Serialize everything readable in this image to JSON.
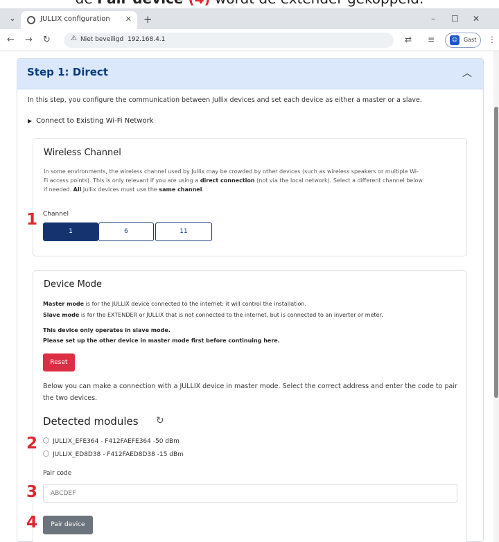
{
  "caption": {
    "prefix": "de ",
    "bold": "Pair device",
    "red": " (4)",
    "suffix": " wordt de extender gekoppeld."
  },
  "browser": {
    "tab_title": "JULLIX configuration",
    "security_label": "Niet beveiligd",
    "url": "192.168.4.1",
    "profile_label": "Gast"
  },
  "accordion": {
    "title": "Step 1: Direct"
  },
  "intro_text": "In this step, you configure the communication between Jullix devices and set each device as either a master or a slave.",
  "wifi_toggle_label": "Connect to Existing Wi-Fi Network",
  "wireless": {
    "title": "Wireless Channel",
    "desc_1": "In some environments, the wireless channel used by Jullix may be crowded by other devices (such as wireless speakers or multiple Wi-",
    "desc_2a": "Fi access points). This is only relevant if you are using a ",
    "desc_2b": "direct connection",
    "desc_2c": " (not via the local network). Select a different channel below",
    "desc_3a": "if needed. ",
    "desc_3b": "All",
    "desc_3c": " Jullix devices must use the ",
    "desc_3d": "same channel",
    "desc_3e": ".",
    "channel_label": "Channel",
    "channels": [
      "1",
      "6",
      "11"
    ],
    "selected": "1"
  },
  "device_mode": {
    "title": "Device Mode",
    "master_b": "Master mode",
    "master_t": " is for the JULLIX device connected to the internet; it will control the installation.",
    "slave_b": "Slave mode",
    "slave_t": " is for the EXTENDER or JULLIX that is not connected to the internet, but is connected to an inverter or meter.",
    "note_1": "This device only operates in slave mode.",
    "note_2": "Please set up the other device in master mode first before continuing here.",
    "reset_label": "Reset",
    "below_text": "Below you can make a connection with a JULLIX device in master mode. Select the correct address and enter the code to pair the two devices.",
    "detected_title": "Detected modules",
    "modules": [
      "JULLIX_EFE364 - F412FAEFE364 -50 dBm",
      "JULLIX_ED8D38 - F412FAED8D38 -15 dBm"
    ],
    "pair_code_label": "Pair code",
    "pair_code_placeholder": "ABCDEF",
    "pair_button_label": "Pair device"
  },
  "markers": [
    "1",
    "2",
    "3",
    "4"
  ],
  "colors": {
    "accent_red": "#e0262e",
    "primary": "#14336f",
    "danger": "#dc2f45",
    "secondary": "#6c757d",
    "header_bg": "#dbe8fc"
  }
}
